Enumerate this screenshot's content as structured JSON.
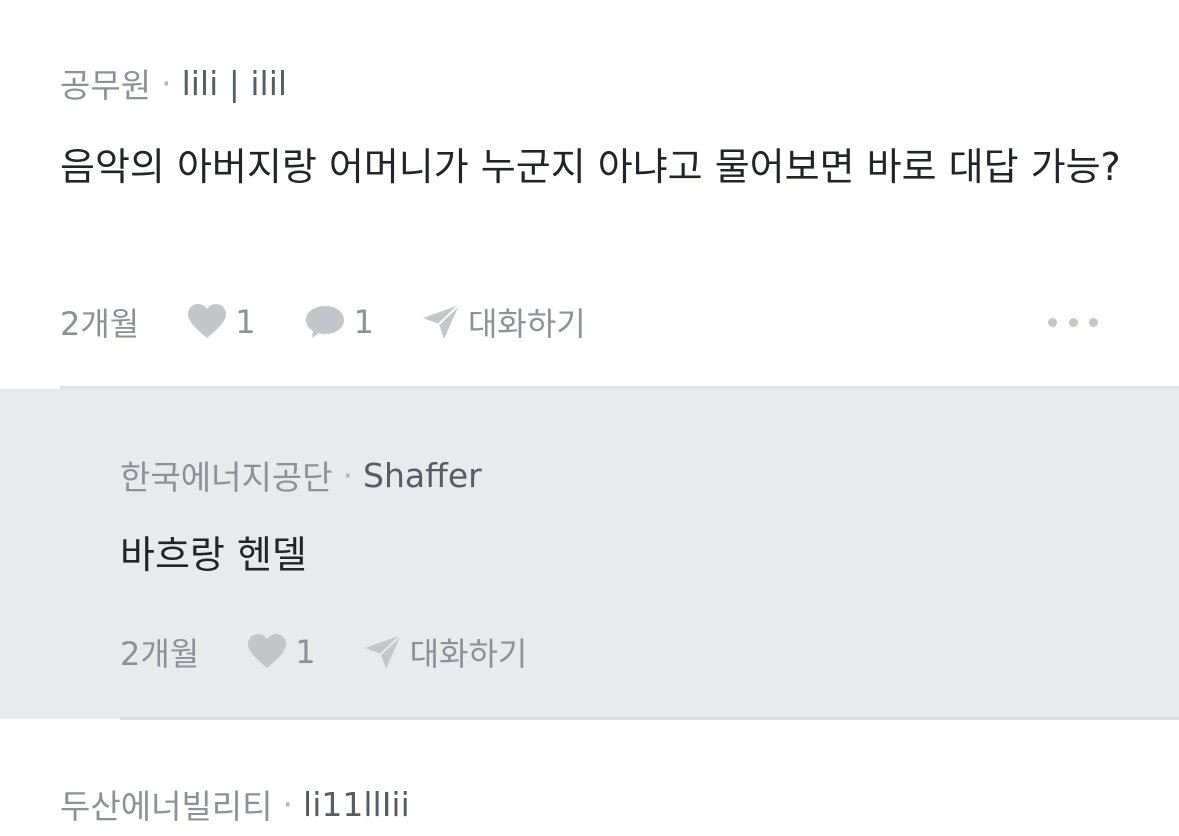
{
  "comment": {
    "company": "공무원",
    "separator": "·",
    "nickname": "lili | ilil",
    "text": "음악의 아버지랑 어머니가 누군지 아냐고 물어보면 바로 대답 가능?",
    "time": "2개월",
    "likes": "1",
    "replies": "1",
    "chat_label": "대화하기"
  },
  "reply": {
    "company": "한국에너지공단",
    "separator": "·",
    "nickname": "Shaffer",
    "text": "바흐랑 헨델",
    "time": "2개월",
    "likes": "1",
    "chat_label": "대화하기"
  },
  "next_comment": {
    "company": "두산에너빌리티",
    "separator": "·",
    "nickname": "li11llIii"
  },
  "colors": {
    "meta_gray": "#8d9096",
    "nickname": "#585c63",
    "body_text": "#222427",
    "icon_gray": "#c4c6ca",
    "reply_bg": "#e9eaec"
  }
}
